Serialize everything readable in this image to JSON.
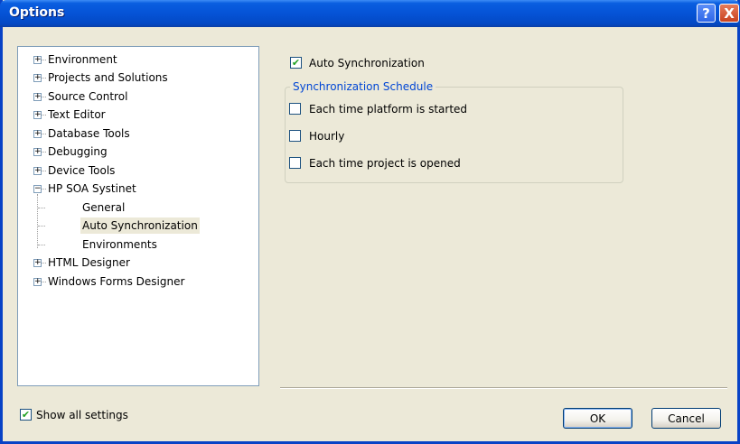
{
  "window": {
    "title": "Options",
    "help_glyph": "?",
    "close_glyph": "X"
  },
  "tree": {
    "items": [
      {
        "label": "Environment",
        "expander": "+"
      },
      {
        "label": "Projects and Solutions",
        "expander": "+"
      },
      {
        "label": "Source Control",
        "expander": "+"
      },
      {
        "label": "Text Editor",
        "expander": "+"
      },
      {
        "label": "Database Tools",
        "expander": "+"
      },
      {
        "label": "Debugging",
        "expander": "+"
      },
      {
        "label": "Device Tools",
        "expander": "+"
      },
      {
        "label": "HP SOA Systinet",
        "expander": "−"
      },
      {
        "label": "General"
      },
      {
        "label": "Auto Synchronization",
        "selected": true
      },
      {
        "label": "Environments"
      },
      {
        "label": "HTML Designer",
        "expander": "+"
      },
      {
        "label": "Windows Forms Designer",
        "expander": "+"
      }
    ]
  },
  "settings": {
    "auto_sync": {
      "label": "Auto Synchronization",
      "checked": true
    },
    "schedule": {
      "legend": "Synchronization Schedule",
      "options": [
        {
          "label": "Each time platform is started",
          "checked": false
        },
        {
          "label": "Hourly",
          "checked": false
        },
        {
          "label": "Each time project is opened",
          "checked": false
        }
      ]
    }
  },
  "footer": {
    "show_all": {
      "label": "Show all settings",
      "checked": true
    },
    "ok_label": "OK",
    "cancel_label": "Cancel"
  },
  "colors": {
    "title_bar": "#0553d6",
    "accent_text": "#0046d5",
    "check_mark": "#21a121"
  }
}
